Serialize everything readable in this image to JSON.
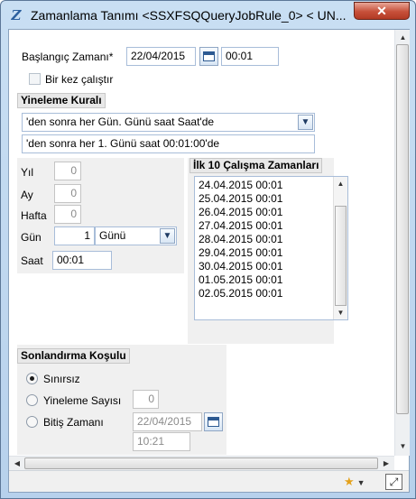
{
  "window": {
    "title": "Zamanlama Tanımı <SSXFSQQueryJobRule_0> < UN...",
    "close_glyph": "✕",
    "app_icon_glyph": "Z"
  },
  "start": {
    "label": "Başlangıç Zamanı*",
    "date": "22/04/2015",
    "time": "00:01",
    "once_label": "Bir kez çalıştır"
  },
  "repeat": {
    "group_title": "Yineleme Kuralı",
    "rule_combo": "'den sonra her Gün. Günü saat Saat'de",
    "rule_text": "'den sonra her 1. Günü saat 00:01:00'de",
    "year_label": "Yıl",
    "year_value": "0",
    "month_label": "Ay",
    "month_value": "0",
    "week_label": "Hafta",
    "week_value": "0",
    "day_label": "Gün",
    "day_value": "1",
    "day_unit": "Günü",
    "hour_label": "Saat",
    "hour_value": "00:01"
  },
  "first_runs": {
    "group_title": "İlk 10 Çalışma Zamanları",
    "items": [
      "24.04.2015 00:01",
      "25.04.2015 00:01",
      "26.04.2015 00:01",
      "27.04.2015 00:01",
      "28.04.2015 00:01",
      "29.04.2015 00:01",
      "30.04.2015 00:01",
      "01.05.2015 00:01",
      "02.05.2015 00:01"
    ]
  },
  "end": {
    "group_title": "Sonlandırma Koşulu",
    "unlimited_label": "Sınırsız",
    "repeat_count_label": "Yineleme Sayısı",
    "repeat_count_value": "0",
    "end_time_label": "Bitiş Zamanı",
    "end_date": "22/04/2015",
    "end_time": "10:21",
    "selected": "unlimited"
  },
  "icons": {
    "star": "star-icon",
    "expand": "expand-icon",
    "calendar": "calendar-icon",
    "dropdown": "chevron-down-icon"
  },
  "colors": {
    "accent": "#2d5a92",
    "close": "#c7503a",
    "star": "#e4a11b"
  }
}
